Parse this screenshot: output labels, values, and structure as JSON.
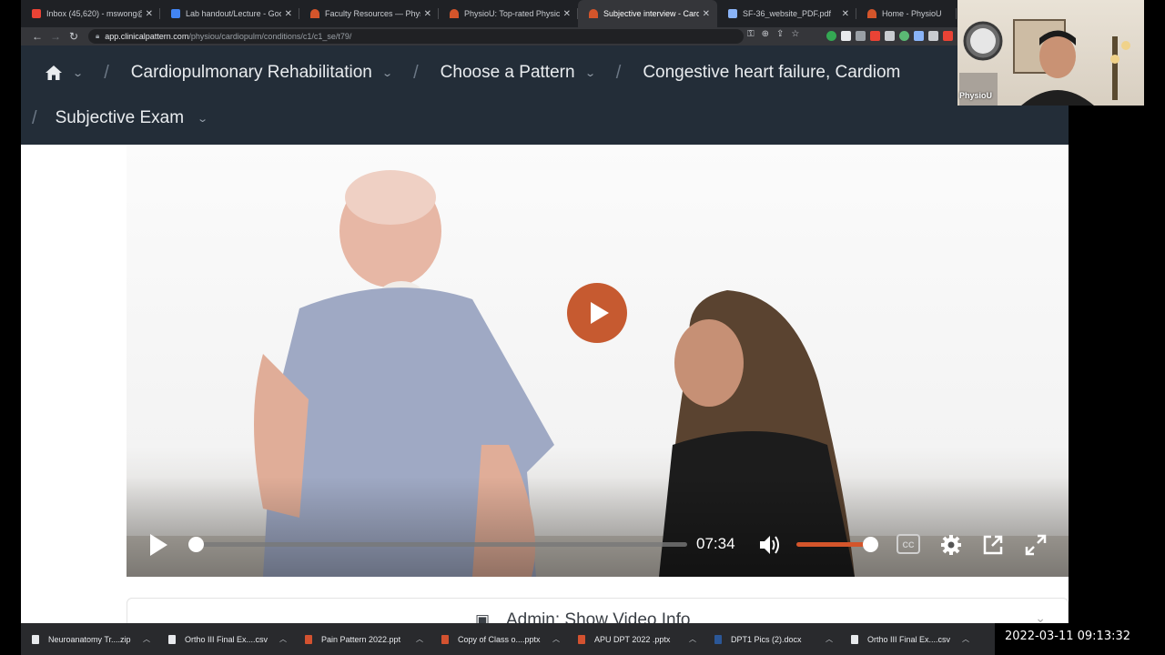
{
  "tabs": [
    {
      "label": "Inbox (45,620) - mswong@ap",
      "favicon": "gmail-icon",
      "active": false
    },
    {
      "label": "Lab handout/Lecture - Google",
      "favicon": "docs-icon",
      "active": false
    },
    {
      "label": "Faculty Resources — PhysioU",
      "favicon": "physiou-icon",
      "active": false
    },
    {
      "label": "PhysioU: Top-rated Physical T",
      "favicon": "physiou-icon",
      "active": false
    },
    {
      "label": "Subjective interview - Cardiop",
      "favicon": "physiou-icon",
      "active": true
    },
    {
      "label": "SF-36_website_PDF.pdf",
      "favicon": "pdf-icon",
      "active": false
    },
    {
      "label": "Home - PhysioU",
      "favicon": "physiou-icon",
      "active": false
    }
  ],
  "address": {
    "host": "app.clinicalpattern.com",
    "path": "/physiou/cardiopulm/conditions/c1/c1_se/t79/"
  },
  "breadcrumb": {
    "level1": "Cardiopulmonary Rehabilitation",
    "level2": "Choose a Pattern",
    "level3": "Congestive heart failure, Cardiom",
    "level4": "Subjective Exam"
  },
  "video": {
    "time": "07:34"
  },
  "admin": {
    "label": "Admin: Show Video Info"
  },
  "webcam": {
    "name": "PhysioU"
  },
  "downloads": [
    {
      "name": "Neuroanatomy Tr....zip",
      "color": "#e8eaed"
    },
    {
      "name": "Ortho III Final Ex....csv",
      "color": "#e8eaed"
    },
    {
      "name": "Pain Pattern 2022.ppt",
      "color": "#d35230"
    },
    {
      "name": "Copy of Class o....pptx",
      "color": "#d35230"
    },
    {
      "name": "APU DPT 2022 .pptx",
      "color": "#d35230"
    },
    {
      "name": "DPT1 Pics (2).docx",
      "color": "#2b5797"
    },
    {
      "name": "Ortho III Final Ex....csv",
      "color": "#e8eaed"
    }
  ],
  "clock": "2022-03-11  09:13:32",
  "colors": {
    "accent": "#c65a30",
    "header": "#232d38"
  }
}
